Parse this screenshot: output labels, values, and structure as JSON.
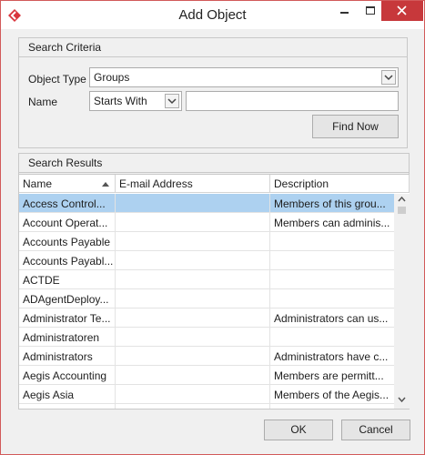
{
  "window": {
    "title": "Add Object"
  },
  "search_criteria": {
    "group_title": "Search Criteria",
    "object_type_label": "Object Type",
    "object_type_value": "Groups",
    "name_label": "Name",
    "name_match_value": "Starts With",
    "name_value": "",
    "find_now_label": "Find Now"
  },
  "search_results": {
    "group_title": "Search Results",
    "columns": [
      "Name",
      "E-mail Address",
      "Description"
    ],
    "sort_column": "Name",
    "sort_direction": "ascending",
    "selected_index": 0,
    "rows": [
      {
        "name": "Access Control...",
        "email": "",
        "description": "Members of this grou..."
      },
      {
        "name": "Account Operat...",
        "email": "",
        "description": "Members can adminis..."
      },
      {
        "name": "Accounts Payable",
        "email": "",
        "description": ""
      },
      {
        "name": "Accounts Payabl...",
        "email": "",
        "description": ""
      },
      {
        "name": "ACTDE",
        "email": "",
        "description": ""
      },
      {
        "name": "ADAgentDeploy...",
        "email": "",
        "description": ""
      },
      {
        "name": "Administrator Te...",
        "email": "",
        "description": "Administrators can us..."
      },
      {
        "name": "Administratoren",
        "email": "",
        "description": ""
      },
      {
        "name": "Administrators",
        "email": "",
        "description": "Administrators have c..."
      },
      {
        "name": "Aegis Accounting",
        "email": "",
        "description": "Members are permitt..."
      },
      {
        "name": "Aegis Asia",
        "email": "",
        "description": "Members of the Aegis..."
      },
      {
        "name": "",
        "email": "",
        "description": ""
      }
    ]
  },
  "footer": {
    "ok_label": "OK",
    "cancel_label": "Cancel"
  },
  "colors": {
    "accent_close": "#c7383b",
    "selection": "#add1f0",
    "app_icon": "#d9363e"
  }
}
